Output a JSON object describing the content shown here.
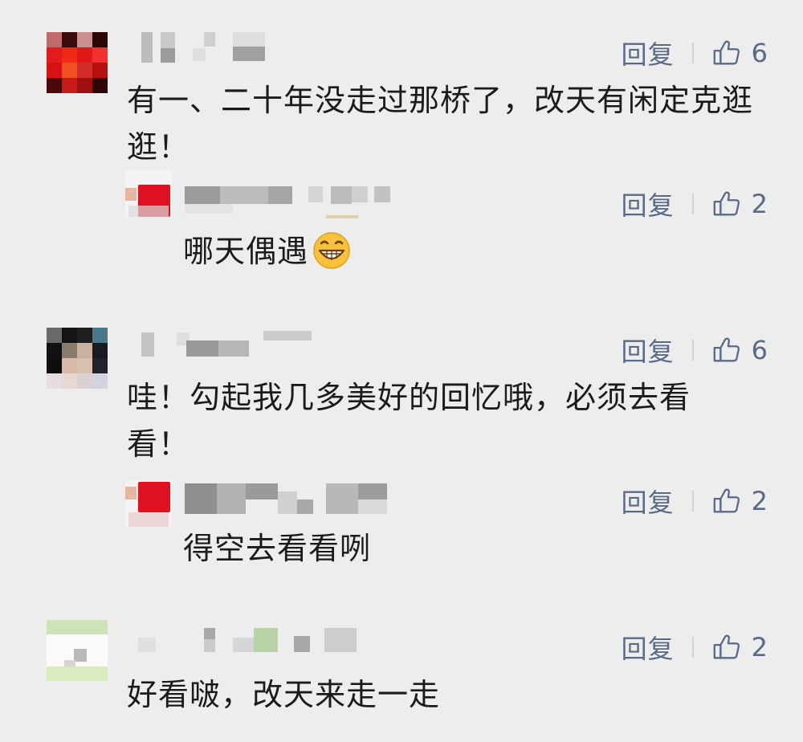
{
  "comments": [
    {
      "text": "有一、二十年没走过那桥了，改天有闲定克逛逛！",
      "reply_label": "回复",
      "likes": "6",
      "replies": [
        {
          "text": "哪天偶遇",
          "emoji": "grinning-face-icon",
          "reply_label": "回复",
          "likes": "2"
        }
      ]
    },
    {
      "text": "哇！勾起我几多美好的回忆哦，必须去看看！",
      "reply_label": "回复",
      "likes": "6",
      "replies": [
        {
          "text": "得空去看看咧",
          "reply_label": "回复",
          "likes": "2"
        }
      ]
    },
    {
      "text": "好看啵，改天来走一走",
      "reply_label": "回复",
      "likes": "2",
      "replies": []
    }
  ],
  "colors": {
    "background": "#ededed",
    "action_text": "#5a6a85",
    "body_text": "#1b1b1b"
  }
}
